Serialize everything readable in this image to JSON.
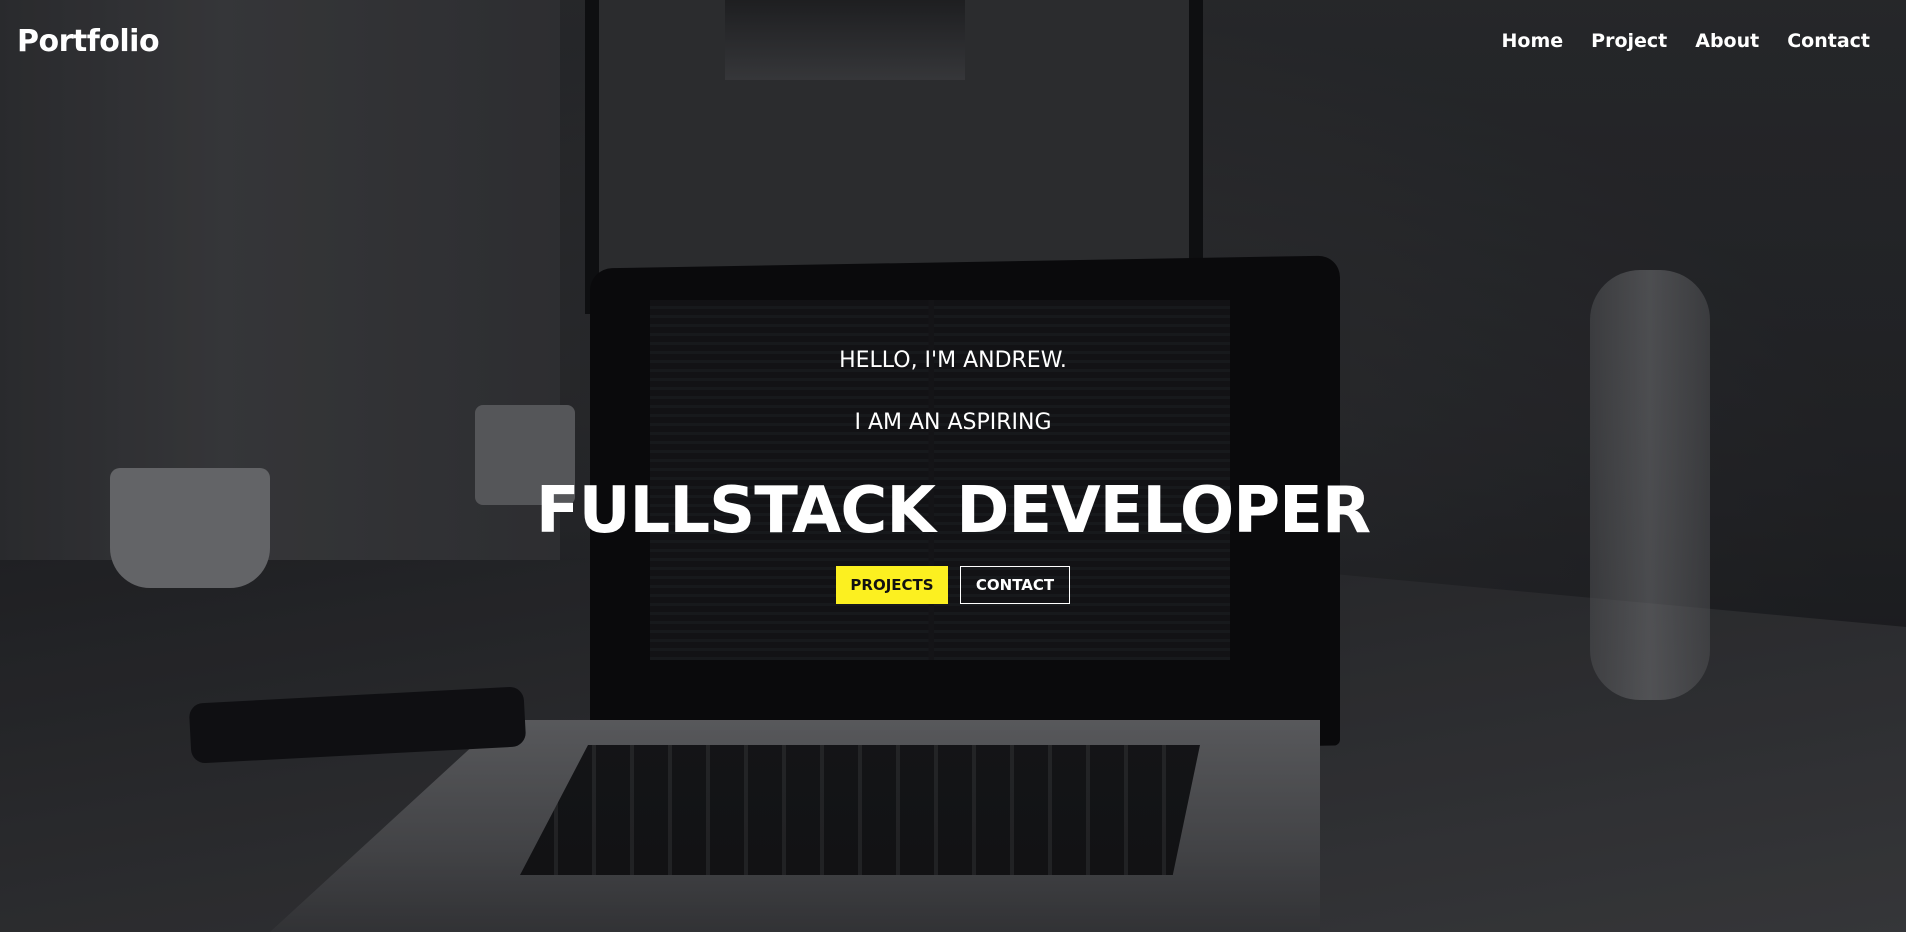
{
  "navbar": {
    "logo": "Portfolio",
    "links": [
      "Home",
      "Project",
      "About",
      "Contact"
    ]
  },
  "hero": {
    "greeting": "HELLO, I'M ANDREW.",
    "aspiring": "I AM AN ASPIRING",
    "role": "FULLSTACK DEVELOPER",
    "buttons": {
      "projects": "PROJECTS",
      "contact": "CONTACT"
    }
  },
  "colors": {
    "accent": "#fcf020",
    "text": "#ffffff"
  }
}
